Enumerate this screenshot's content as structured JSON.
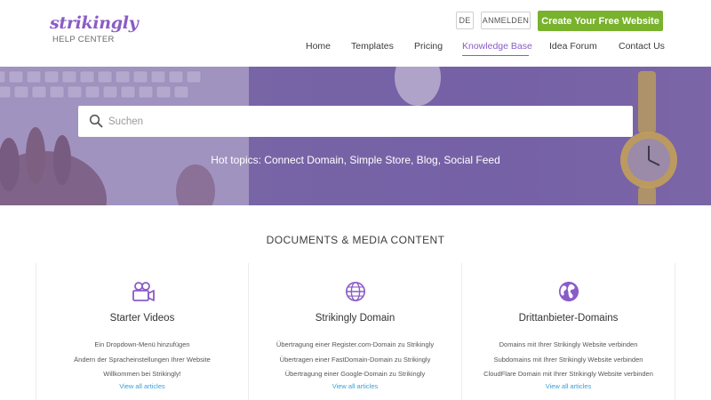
{
  "brand": {
    "logo_text": "strikingly",
    "logo_subtitle": "HELP CENTER",
    "accent_color": "#8a5cc7",
    "cta_color": "#79b22c"
  },
  "header": {
    "lang_label": "DE",
    "login_label": "ANMELDEN",
    "cta_label": "Create Your Free Website"
  },
  "nav": {
    "items": [
      {
        "label": "Home"
      },
      {
        "label": "Templates"
      },
      {
        "label": "Pricing"
      },
      {
        "label": "Knowledge Base",
        "active": true
      },
      {
        "label": "Idea Forum"
      },
      {
        "label": "Contact Us"
      }
    ]
  },
  "hero": {
    "search_placeholder": "Suchen",
    "hot_topics": "Hot topics: Connect Domain, Simple Store, Blog, Social Feed"
  },
  "section": {
    "title": "DOCUMENTS & MEDIA CONTENT"
  },
  "categories": [
    {
      "icon": "video-camera-icon",
      "title": "Starter Videos",
      "articles": [
        "Ein Dropdown-Menü hinzufügen",
        "Ändern der Spracheinstellungen Ihrer Website",
        "Willkommen bei Strikingly!"
      ],
      "view_all": "View all articles"
    },
    {
      "icon": "globe-icon",
      "title": "Strikingly Domain",
      "articles": [
        "Übertragung einer Register.com-Domain zu Strikingly",
        "Übertragen einer FastDomain-Domain zu Strikingly",
        "Übertragung einer Google-Domain zu Strikingly"
      ],
      "view_all": "View all articles"
    },
    {
      "icon": "earth-globe-icon",
      "title": "Drittanbieter-Domains",
      "articles": [
        "Domains mit Ihrer Strikingly Website verbinden",
        "Subdomains mit Ihrer Strikingly Website verbinden",
        "CloudFlare Domain mit Ihrer Strikingly Website verbinden"
      ],
      "view_all": "View all articles"
    }
  ]
}
